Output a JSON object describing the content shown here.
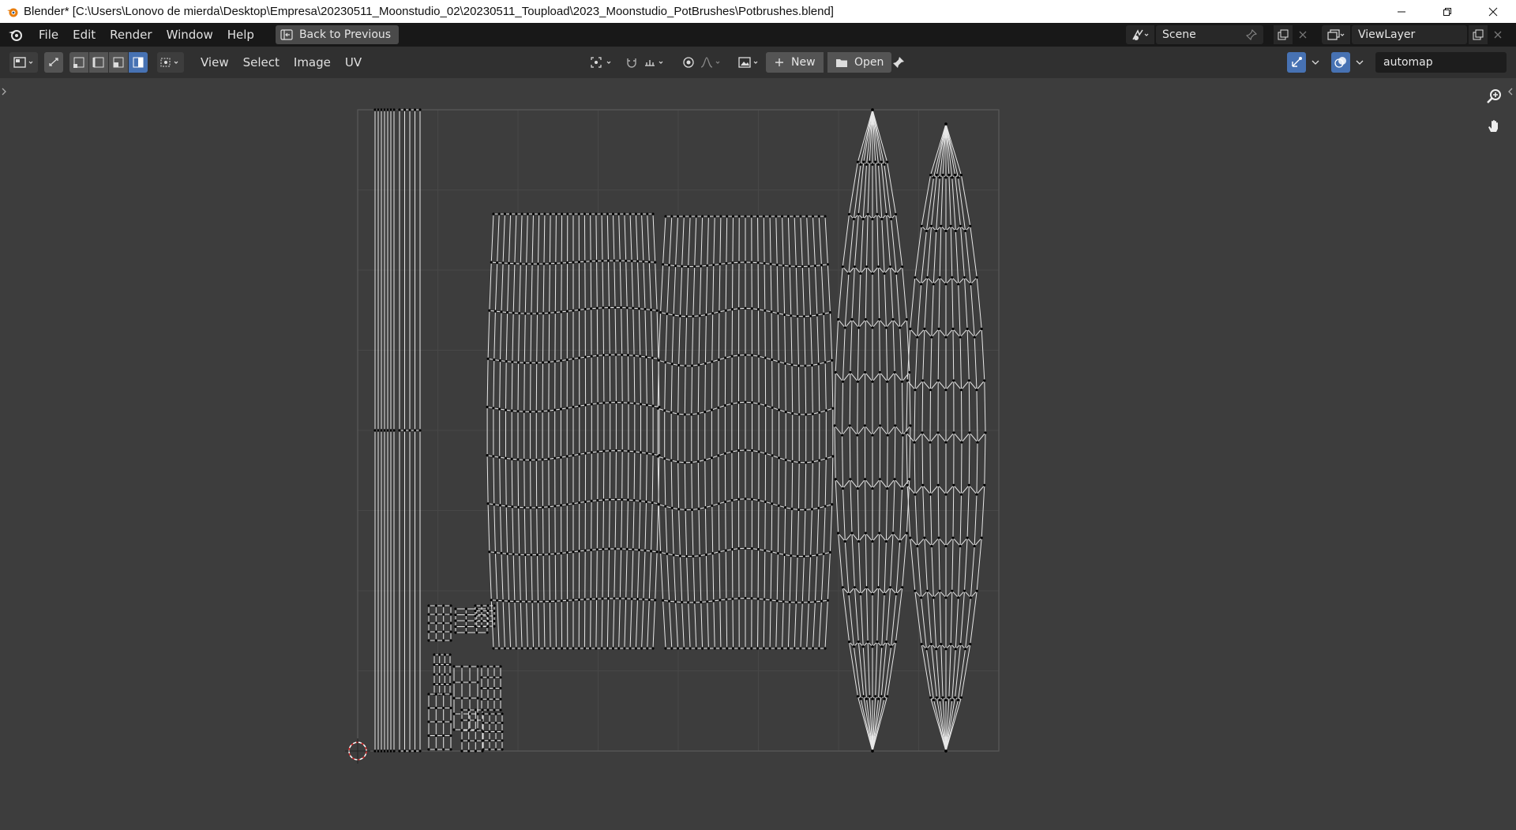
{
  "window": {
    "title": "Blender* [C:\\Users\\Lonovo de mierda\\Desktop\\Empresa\\20230511_Moonstudio_02\\20230511_Toupload\\2023_Moonstudio_PotBrushes\\Potbrushes.blend]",
    "controls": [
      "minimize-icon",
      "restore-icon",
      "close-icon"
    ]
  },
  "topbar": {
    "menus": [
      "File",
      "Edit",
      "Render",
      "Window",
      "Help"
    ],
    "back_label": "Back to Previous",
    "scene_name": "Scene",
    "view_layer": "ViewLayer"
  },
  "header": {
    "menus": [
      "View",
      "Select",
      "Image",
      "UV"
    ],
    "new_label": "New",
    "open_label": "Open",
    "image_name": "automap"
  },
  "colors": {
    "title_bg": "#ffffff",
    "topbar_bg": "#181818",
    "header_bg": "#303030",
    "viewport_bg": "#3d3d3d",
    "active_toggle": "#4772b3",
    "wire": "#e8e8e8",
    "vertex": "#000000",
    "cursor": "#e03030"
  }
}
